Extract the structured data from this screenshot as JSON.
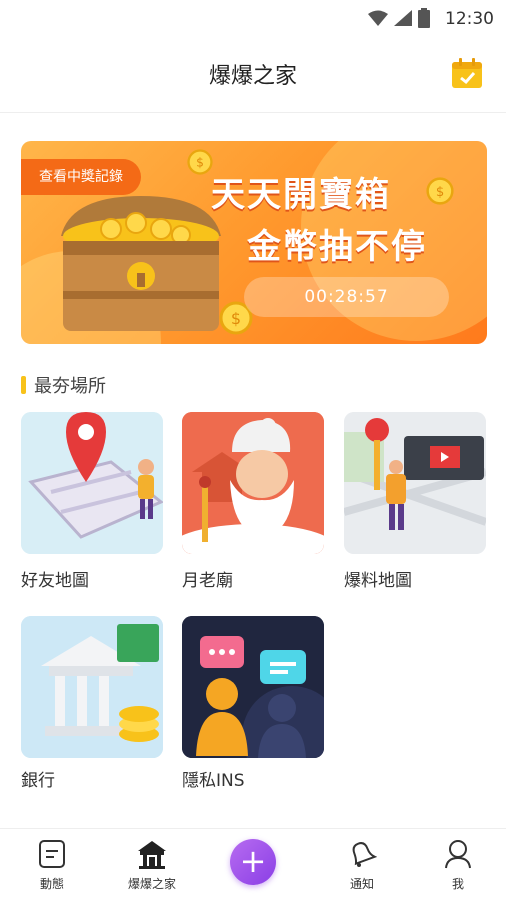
{
  "status_bar": {
    "time": "12:30"
  },
  "header": {
    "title": "爆爆之家"
  },
  "banner": {
    "record_label": "查看中獎記錄",
    "headline_1": "天天開寶箱",
    "headline_2": "金幣抽不停",
    "countdown": "00:28:57"
  },
  "section": {
    "title": "最夯場所"
  },
  "places": [
    {
      "label": "好友地圖"
    },
    {
      "label": "月老廟"
    },
    {
      "label": "爆料地圖"
    },
    {
      "label": "銀行"
    },
    {
      "label": "隱私INS"
    }
  ],
  "nav": {
    "items": [
      {
        "label": "動態"
      },
      {
        "label": "爆爆之家"
      },
      {
        "label": "+"
      },
      {
        "label": "通知"
      },
      {
        "label": "我"
      }
    ]
  },
  "colors": {
    "accent": "#f8c21a",
    "plus": "#9b4deb",
    "banner": "#ff9a2e"
  }
}
